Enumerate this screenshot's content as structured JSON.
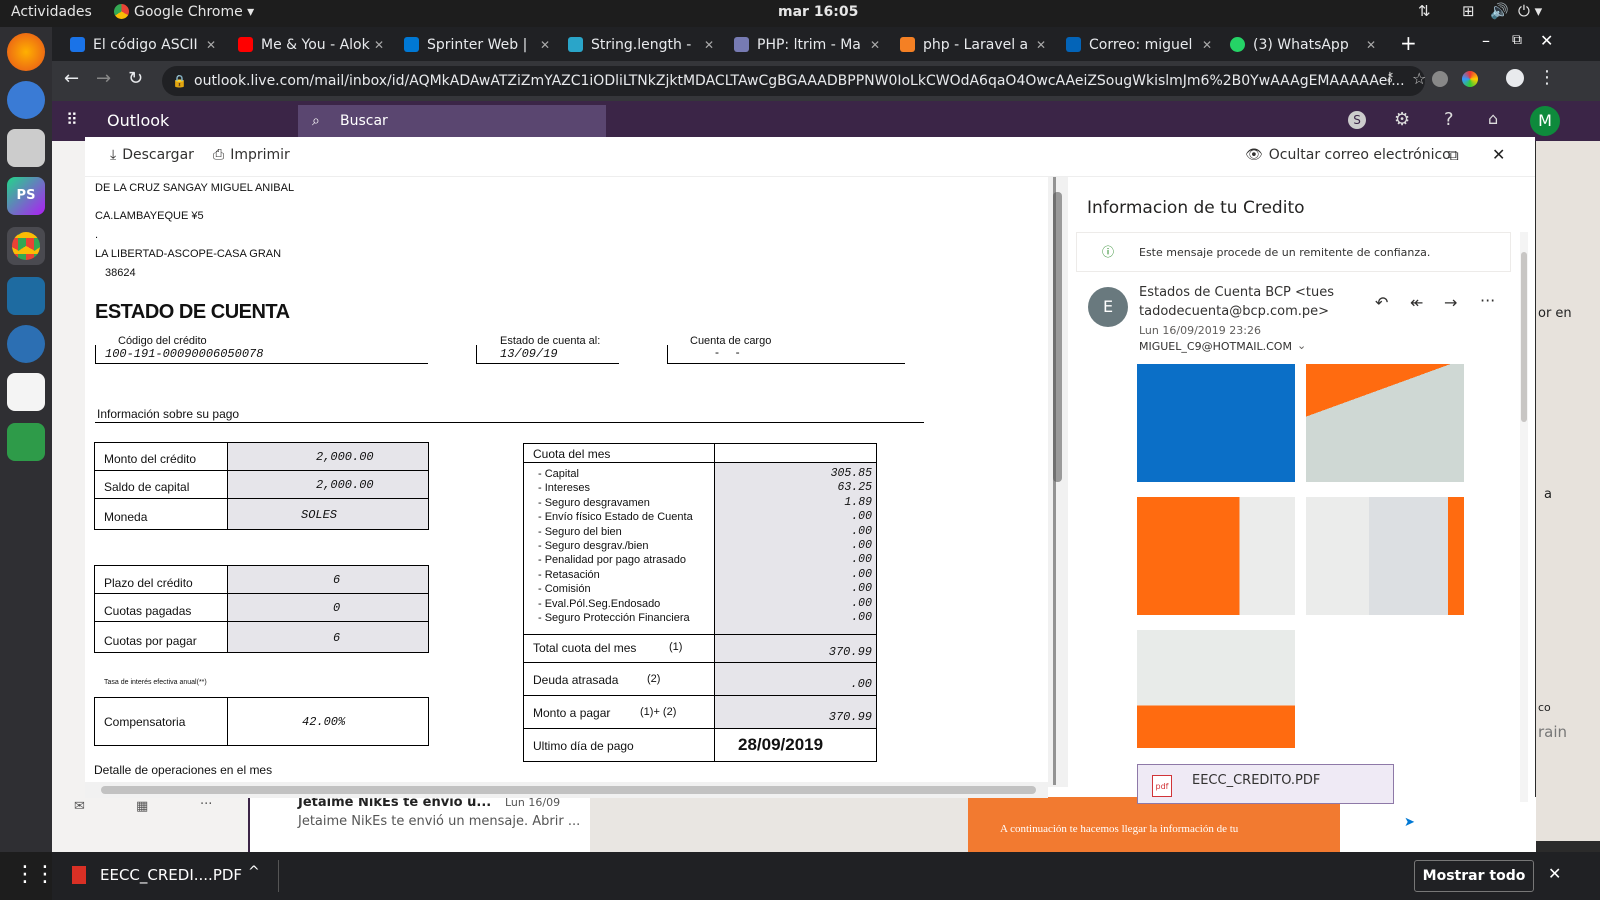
{
  "system": {
    "activities": "Actividades",
    "app": "Google Chrome ▾",
    "clock": "mar 16:05"
  },
  "tabs": [
    {
      "label": "El código ASCII",
      "color": "#1a73e8"
    },
    {
      "label": "Me & You - Alok",
      "color": "#ff0000"
    },
    {
      "label": "Sprinter Web |",
      "color": "#0078d4"
    },
    {
      "label": "String.length -",
      "color": "#2aa5c9"
    },
    {
      "label": "PHP: ltrim - Ma",
      "color": "#777bb3"
    },
    {
      "label": "php - Laravel a",
      "color": "#f48024"
    },
    {
      "label": "Correo: miguel",
      "color": "#0364b8"
    },
    {
      "label": "(3) WhatsApp",
      "color": "#25d366"
    }
  ],
  "browser": {
    "url": "outlook.live.com/mail/inbox/id/AQMkADAwATZiZmYAZC1iODliLTNkZjktMDACLTAwCgBGAAADBPPNW0IoLkCWOdA6qaO4OwcAAeiZSougWkislmJm6%2B0YwAAAgEMAAAAAei..."
  },
  "outlook": {
    "brand": "Outlook",
    "search": "Buscar",
    "avatar": "M"
  },
  "viewer": {
    "download": "Descargar",
    "print": "Imprimir",
    "hide_email": "Ocultar correo electrónico"
  },
  "document": {
    "name": "DE LA CRUZ SANGAY MIGUEL ANIBAL",
    "addr1": "CA.LAMBAYEQUE ¥5",
    "dot": ".",
    "addr2": "LA LIBERTAD-ASCOPE-CASA GRAN",
    "zip": "38624",
    "title": "ESTADO DE CUENTA",
    "codigo_label": "Código del crédito",
    "codigo_value": "100-191-00090006050078",
    "estado_label": "Estado de cuenta al:",
    "estado_value": "13/09/19",
    "cargo_label": "Cuenta de cargo",
    "cargo_value": "-     -",
    "pago_header": "Información sobre su pago",
    "monto_credito_label": "Monto del crédito",
    "monto_credito_value": "2,000.00",
    "saldo_label": "Saldo de capital",
    "saldo_value": "2,000.00",
    "moneda_label": "Moneda",
    "moneda_value": "SOLES",
    "plazo_label": "Plazo del crédito",
    "plazo_value": "6",
    "pagadas_label": "Cuotas pagadas",
    "pagadas_value": "0",
    "por_pagar_label": "Cuotas por pagar",
    "por_pagar_value": "6",
    "tasa_label": "Tasa de interés efectiva anual(**)",
    "comp_label": "Compensatoria",
    "comp_value": "42.00%",
    "cuota_header": "Cuota del mes",
    "cuota_items": [
      {
        "label": "- Capital",
        "value": "305.85"
      },
      {
        "label": "- Intereses",
        "value": "63.25"
      },
      {
        "label": "- Seguro desgravamen",
        "value": "1.89"
      },
      {
        "label": "- Envío físico Estado de Cuenta",
        "value": ".00"
      },
      {
        "label": "- Seguro del bien",
        "value": ".00"
      },
      {
        "label": "- Seguro desgrav./bien",
        "value": ".00"
      },
      {
        "label": "- Penalidad por pago atrasado",
        "value": ".00"
      },
      {
        "label": "- Retasación",
        "value": ".00"
      },
      {
        "label": "- Comisión",
        "value": ".00"
      },
      {
        "label": "- Eval.Pól.Seg.Endosado",
        "value": ".00"
      },
      {
        "label": "- Seguro Protección Financiera",
        "value": ".00"
      }
    ],
    "total_label": "Total cuota del mes",
    "total_ref": "(1)",
    "total_value": "370.99",
    "deuda_label": "Deuda atrasada",
    "deuda_ref": "(2)",
    "deuda_value": ".00",
    "monto_pagar_label": "Monto a pagar",
    "monto_pagar_ref": "(1)+ (2)",
    "monto_pagar_value": "370.99",
    "ultimo_label": "Ultimo día de pago",
    "ultimo_value": "28/09/2019",
    "detalle": "Detalle de operaciones en el mes"
  },
  "info": {
    "subject": "Informacion de tu Credito",
    "trust": "Este mensaje procede de un remitente de confianza.",
    "sender_initial": "E",
    "sender_line1": "Estados de Cuenta BCP <tues",
    "sender_line2": "tadodecuenta@bcp.com.pe>",
    "date": "Lun 16/09/2019 23:26",
    "to": "MIGUEL_C9@HOTMAIL.COM",
    "attachment": "EECC_CREDITO.PDF"
  },
  "background": {
    "mail_from": "Jetaime NikEs te envió u...",
    "mail_date": "Lun 16/09",
    "mail_preview": "Jetaime NikEs te envió un mensaje. Abrir ...",
    "banner": "A continuación te hacemos llegar la información de tu",
    "right1": "or en",
    "right2": "a",
    "right3": "co",
    "right4": "rain"
  },
  "downloads": {
    "file": "EECC_CREDI....PDF",
    "show_all": "Mostrar todo"
  }
}
